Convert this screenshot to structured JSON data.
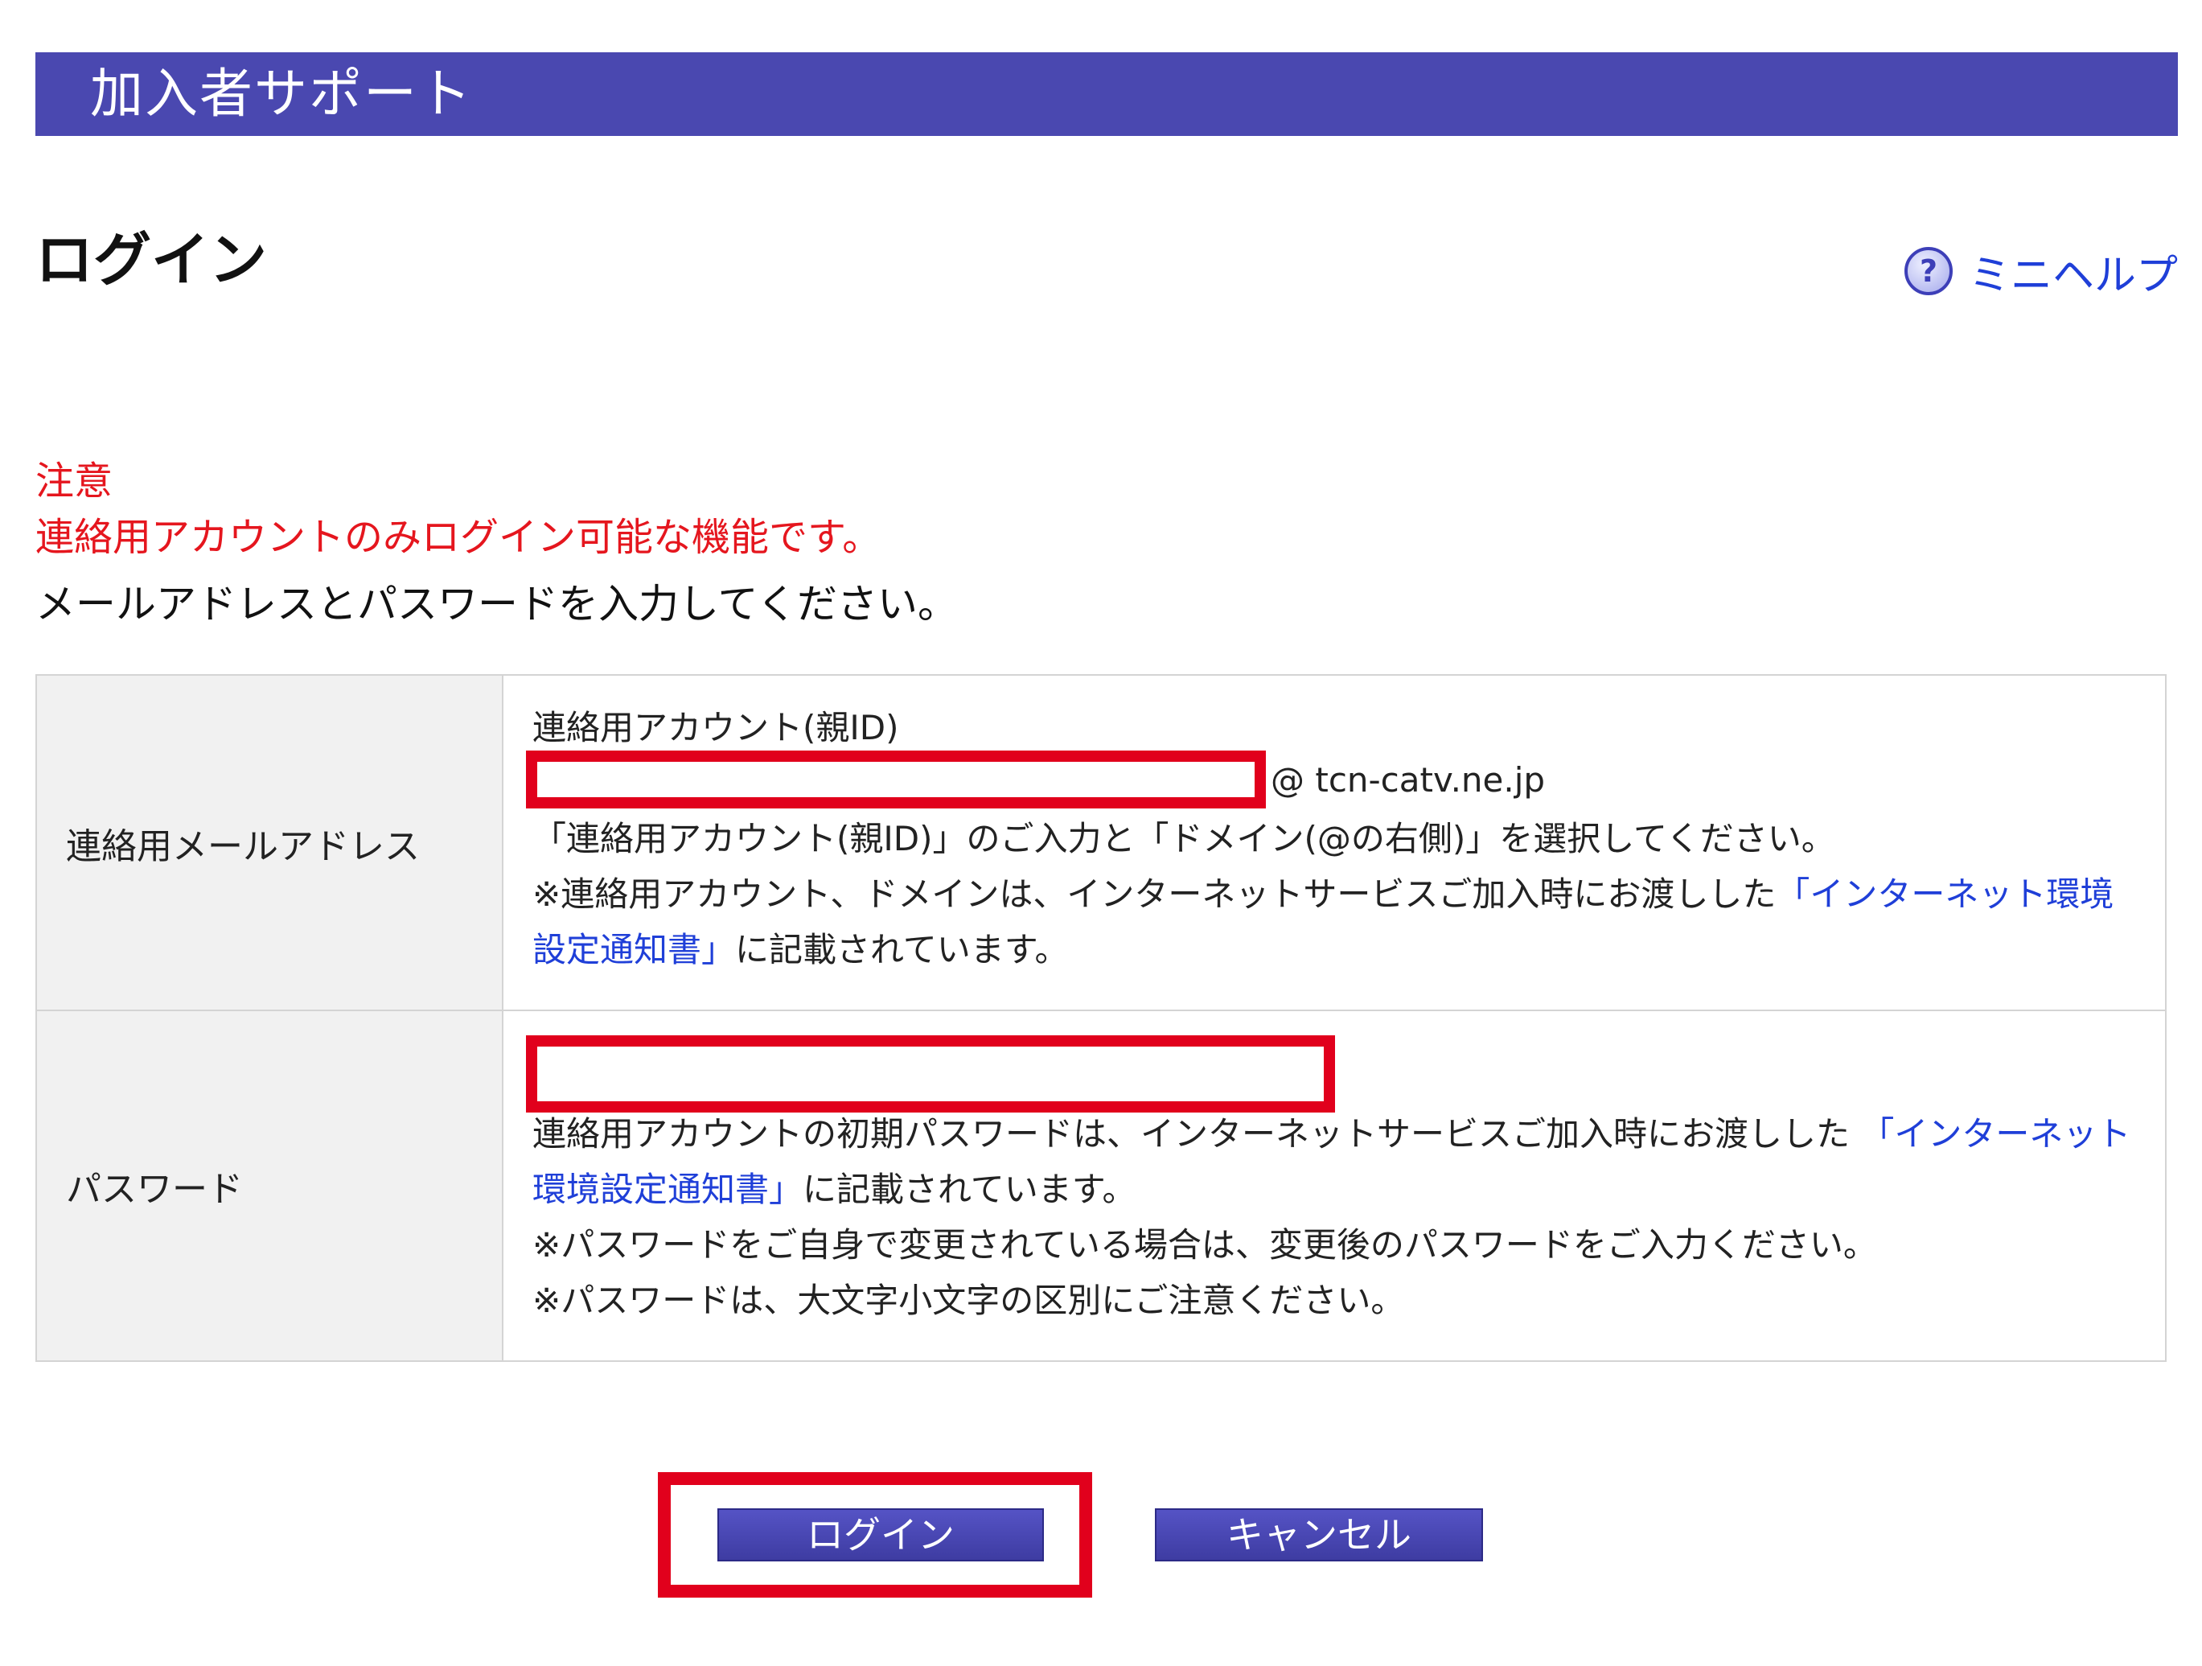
{
  "header": {
    "title": "加入者サポート"
  },
  "page": {
    "title": "ログイン",
    "help_label": "ミニヘルプ"
  },
  "notice": {
    "heading": "注意",
    "text": "連絡用アカウントのみログイン可能な機能です。"
  },
  "instruction": "メールアドレスとパスワードを入力してください。",
  "form": {
    "email": {
      "label": "連絡用メールアドレス",
      "account_caption": "連絡用アカウント(親ID)",
      "input_value": "",
      "domain": "@ tcn-catv.ne.jp",
      "note_1": "「連絡用アカウント(親ID)」のご入力と「ドメイン(@の右側)」を選択してください。",
      "note_2_prefix": "※連絡用アカウント、ドメインは、インターネットサービスご加入時にお渡しした",
      "note_2_link": "「インターネット環境設定通知書」",
      "note_2_suffix": "に記載されています。"
    },
    "password": {
      "label": "パスワード",
      "input_value": "",
      "note_1_prefix": "連絡用アカウントの初期パスワードは、インターネットサービスご加入時にお渡しした ",
      "note_1_link": "「インターネット環境設定通知書」",
      "note_1_suffix": "に記載されています。",
      "note_2": "※パスワードをご自身で変更されている場合は、変更後のパスワードをご入力ください。",
      "note_3": "※パスワードは、大文字小文字の区別にご注意ください。"
    }
  },
  "buttons": {
    "login": "ログイン",
    "cancel": "キャンセル"
  },
  "colors": {
    "header_bg": "#4a48b0",
    "notice_red": "#e5161e",
    "link_blue": "#1f3fd8",
    "highlight_red": "#e1001c",
    "label_cell_bg": "#f1f1f1"
  },
  "icons": {
    "help": "question-circle-icon"
  }
}
